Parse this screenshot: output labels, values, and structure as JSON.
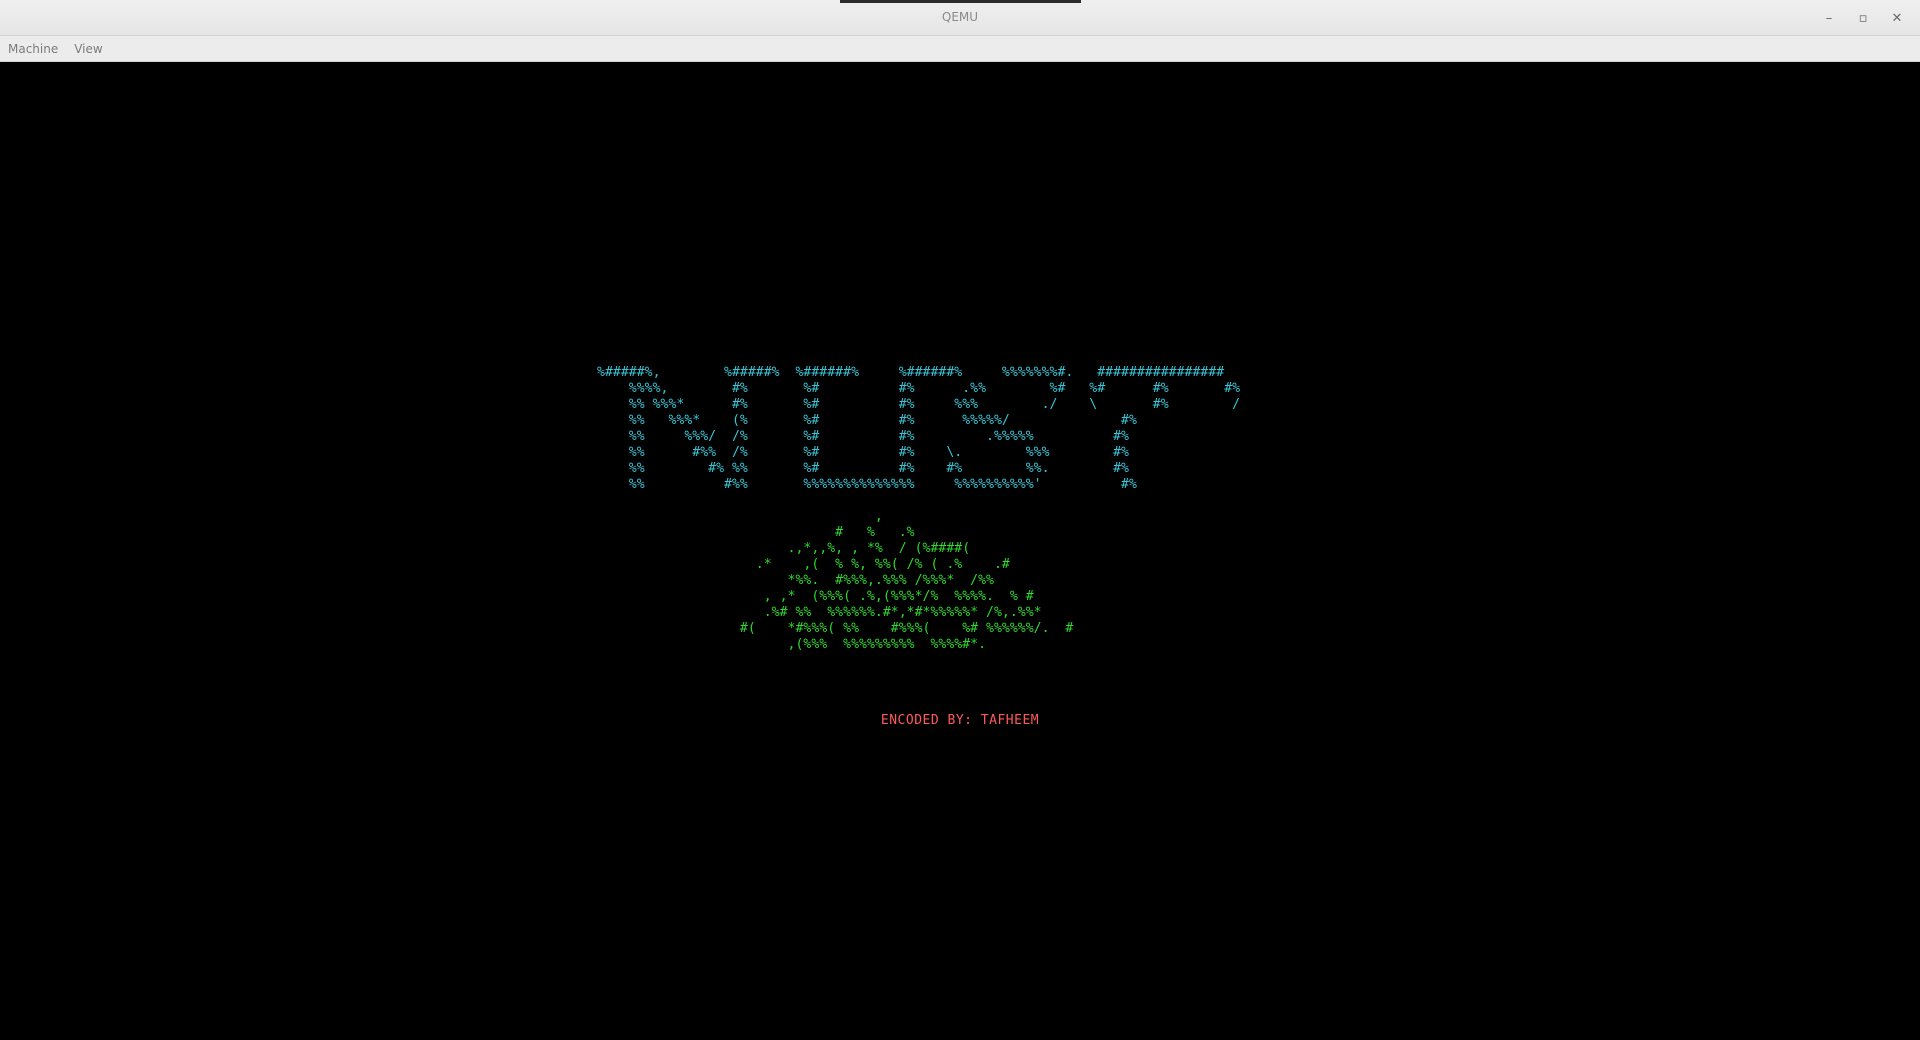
{
  "window": {
    "title": "QEMU",
    "controls": {
      "minimize": "–",
      "maximize": "▫",
      "close": "✕"
    }
  },
  "menu": {
    "items": [
      {
        "label": "Machine"
      },
      {
        "label": "View"
      }
    ]
  },
  "screen": {
    "logo_art": "%#####%,        %#####%  %######%     %######%     %%%%%%%#.   ################\n    %%%%,        #%       %#          #%      .%%        %#   %#      #%       #%\n    %% %%%*      #%       %#          #%     %%%        ./    \\       #%        /\n    %%   %%%*    (%       %#          #%      %%%%%/              #%\n    %%     %%%/  /%       %#          #%         .%%%%%          #%\n    %%      #%%  /%       %#          #%    \\.        %%%        #%\n    %%        #% %%       %#          #%    #%        %%.        #%\n    %%          #%%       %%%%%%%%%%%%%%     %%%%%%%%%%'          #%",
    "ship_art": "                                   ,\n                              #   %   .%\n                        .,*,,%, , *%  / (%####(\n                    .*    ,(  % %, %%( /% ( .%    .#\n                        *%%.  #%%%,.%%% /%%%*  /%%\n                     , ,*  (%%%( .%,(%%%*/%  %%%%.  % #\n                     .%# %%  %%%%%%.#*,*#*%%%%%* /%,.%%*\n                  #(    *#%%%( %%    #%%%(    %# %%%%%%/.  #\n                        ,(%%%  %%%%%%%%%  %%%%#*.",
    "credit": "ENCODED BY: TAFHEEM",
    "colors": {
      "logo": "#39c5d6",
      "ship": "#2fd72f",
      "credit": "#ff5a5a"
    }
  }
}
